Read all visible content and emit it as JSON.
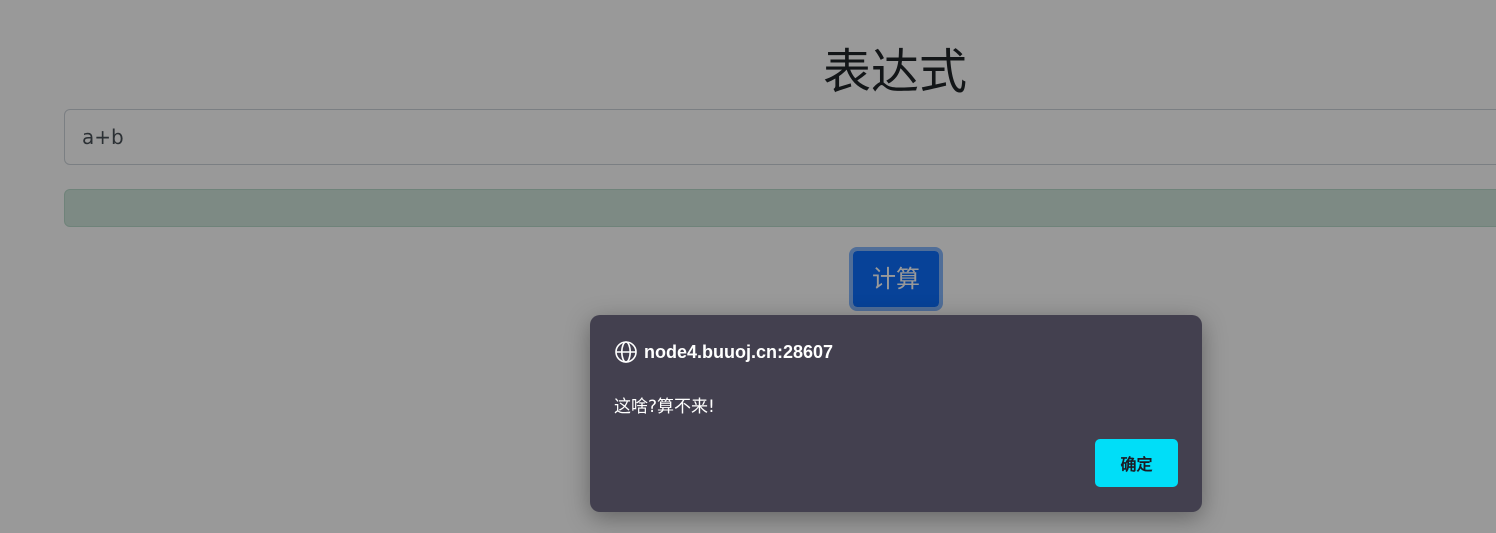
{
  "page": {
    "title": "表达式",
    "expression_input": {
      "value": "a+b"
    },
    "result_text": "",
    "calc_button_label": "计算"
  },
  "alert": {
    "origin": "node4.buuoj.cn:28607",
    "message": "这啥?算不来!",
    "ok_label": "确定",
    "icon": "globe-icon"
  },
  "colors": {
    "primary": "#0d6efd",
    "result_background": "#d1e7dd",
    "dialog_background": "#43404f",
    "dialog_button": "#00def8",
    "overlay": "rgba(0,0,0,0.40)"
  }
}
